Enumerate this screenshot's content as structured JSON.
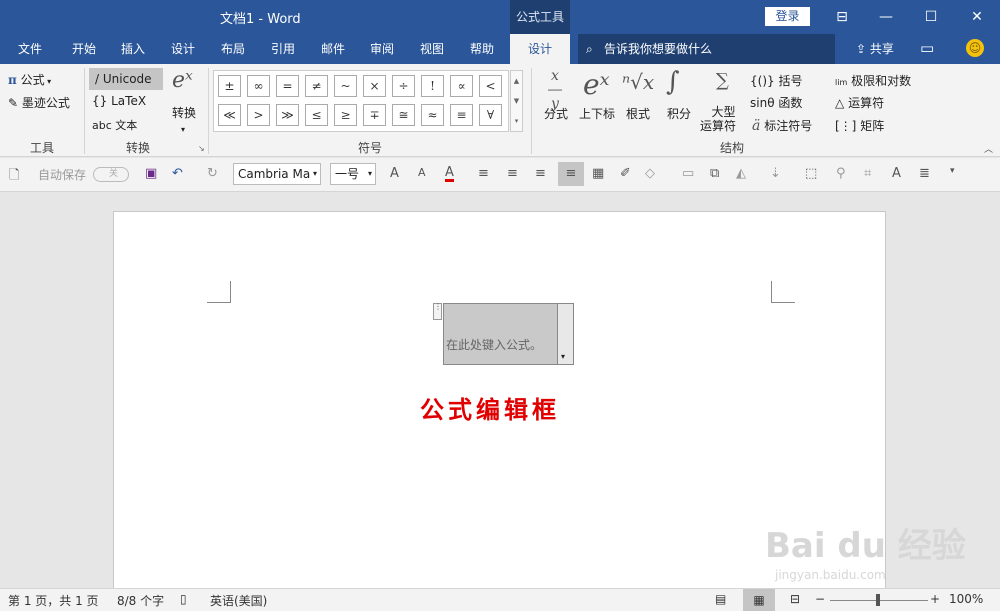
{
  "titlebar": {
    "doc_title": "文档1  -  Word",
    "context_tab": "公式工具",
    "login": "登录",
    "ribbon_display": "⊟",
    "minimize": "—",
    "maximize": "☐",
    "close": "✕"
  },
  "menu": {
    "tabs": [
      "文件",
      "开始",
      "插入",
      "设计",
      "布局",
      "引用",
      "邮件",
      "审阅",
      "视图",
      "帮助",
      "设计"
    ],
    "active_index": 10,
    "tellme": "告诉我你想要做什么",
    "share": "共享"
  },
  "ribbon": {
    "tools": {
      "formula": "公式",
      "ink": "墨迹公式",
      "label": "工具"
    },
    "convert": {
      "unicode": "Unicode",
      "latex": "LaTeX",
      "abc": "abc 文本",
      "convert": "转换",
      "label": "转换"
    },
    "symbols": {
      "row1": [
        "±",
        "∞",
        "=",
        "≠",
        "~",
        "×",
        "÷",
        "!",
        "∝",
        "<"
      ],
      "row2": [
        "≪",
        ">",
        "≫",
        "≤",
        "≥",
        "∓",
        "≅",
        "≈",
        "≡",
        "∀"
      ],
      "label": "符号"
    },
    "structures": {
      "fraction": "分式",
      "script": "上下标",
      "radical": "根式",
      "integral": "积分",
      "large_op1": "大型",
      "large_op2": "运算符",
      "bracket": "{()} 括号",
      "function": "sinθ 函数",
      "accent": "标注符号",
      "limit": "极限和对数",
      "operator": "运算符",
      "matrix": "矩阵",
      "label": "结构"
    }
  },
  "qat": {
    "autosave": "自动保存",
    "autosave_state": "关",
    "font": "Cambria Ma",
    "size": "一号"
  },
  "document": {
    "eq_placeholder": "在此处键入公式。",
    "annotation": "公式编辑框"
  },
  "watermark": {
    "brand": "Bai du 经验",
    "url": "jingyan.baidu.com"
  },
  "status": {
    "page": "第 1 页，共 1 页",
    "words": "8/8 个字",
    "language": "英语(美国)",
    "zoom": "100%"
  }
}
